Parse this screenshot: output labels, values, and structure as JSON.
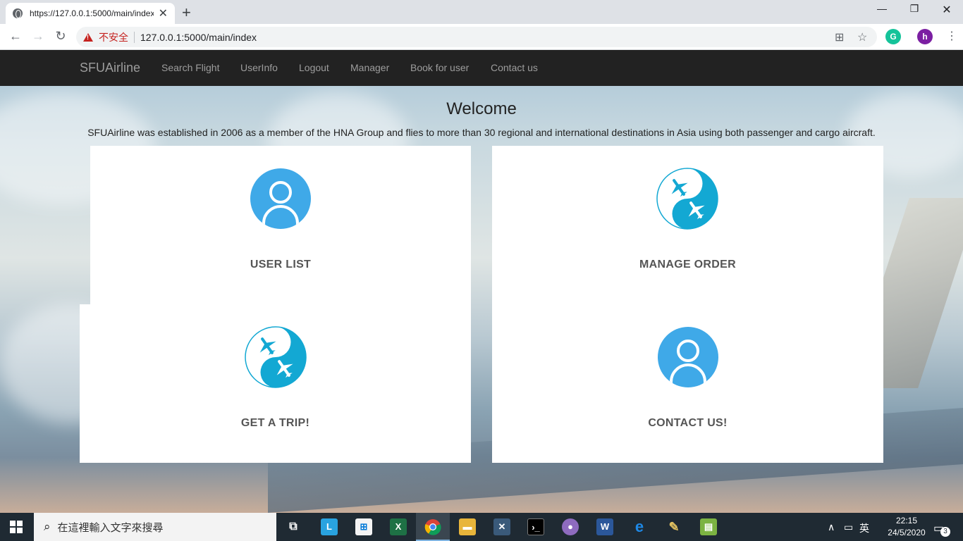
{
  "browser": {
    "tab_title": "https://127.0.0.1:5000/main/index",
    "insecure_label": "不安全",
    "url": "127.0.0.1:5000/main/index",
    "profile_initial": "h"
  },
  "navbar": {
    "brand": "SFUAirline",
    "links": [
      "Search Flight",
      "UserInfo",
      "Logout",
      "Manager",
      "Book for user",
      "Contact us"
    ]
  },
  "hero": {
    "title": "Welcome",
    "intro": "SFUAirline was established in 2006 as a member of the HNA Group and flies to more than 30 regional and international destinations in Asia using both passenger and cargo aircraft."
  },
  "cards": [
    {
      "label": "USER LIST",
      "icon": "user-icon"
    },
    {
      "label": "MANAGE ORDER",
      "icon": "airplane-icon"
    },
    {
      "label": "GET A TRIP!",
      "icon": "airplane-icon"
    },
    {
      "label": "CONTACT US!",
      "icon": "user-icon"
    }
  ],
  "taskbar": {
    "search_placeholder": "在這裡輸入文字來搜尋",
    "ime": "英",
    "time": "22:15",
    "date": "24/5/2020",
    "notifications": "3"
  },
  "colors": {
    "navbar_bg": "#222222",
    "icon_blue": "#3fa9e8",
    "plane_teal": "#13a8d3"
  }
}
